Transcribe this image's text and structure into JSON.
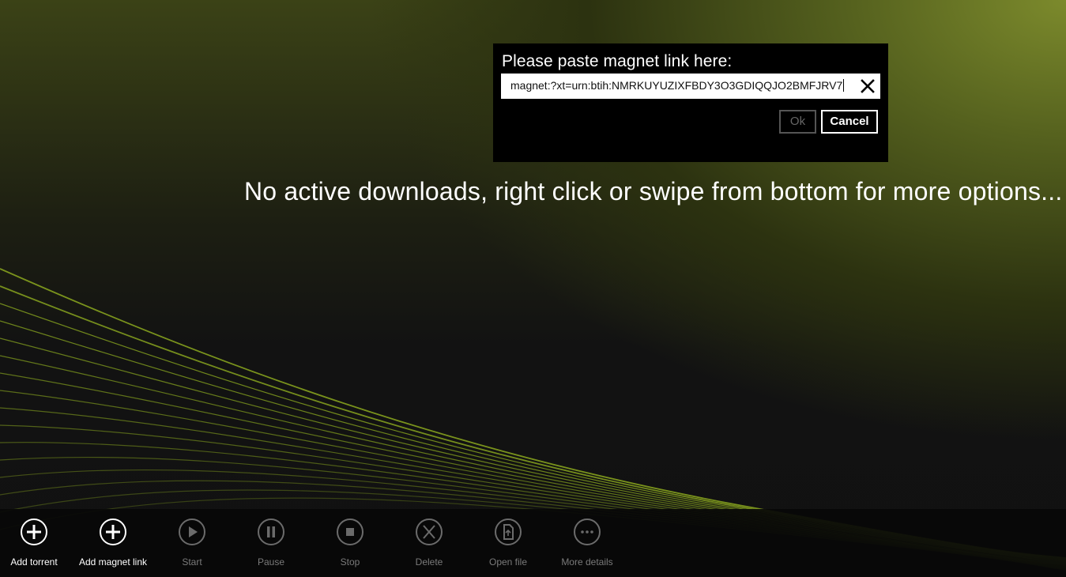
{
  "dialog": {
    "title": "Please paste magnet link here:",
    "input_value": "magnet:?xt=urn:btih:NMRKUYUZIXFBDY3O3GDIQQJO2BMFJRV7",
    "ok_label": "Ok",
    "cancel_label": "Cancel"
  },
  "main": {
    "empty_message": "No active downloads, right click or swipe from bottom for more options..."
  },
  "appbar": {
    "items": [
      {
        "label": "Add torrent",
        "icon": "plus-icon",
        "enabled": true
      },
      {
        "label": "Add magnet link",
        "icon": "plus-icon",
        "enabled": true
      },
      {
        "label": "Start",
        "icon": "play-icon",
        "enabled": false
      },
      {
        "label": "Pause",
        "icon": "pause-icon",
        "enabled": false
      },
      {
        "label": "Stop",
        "icon": "stop-icon",
        "enabled": false
      },
      {
        "label": "Delete",
        "icon": "delete-icon",
        "enabled": false
      },
      {
        "label": "Open file",
        "icon": "file-icon",
        "enabled": false
      },
      {
        "label": "More details",
        "icon": "more-icon",
        "enabled": false
      }
    ]
  },
  "colors": {
    "accent": "#7c8a2c",
    "wave": "#7f9a1e",
    "dialog_bg": "#000000"
  }
}
